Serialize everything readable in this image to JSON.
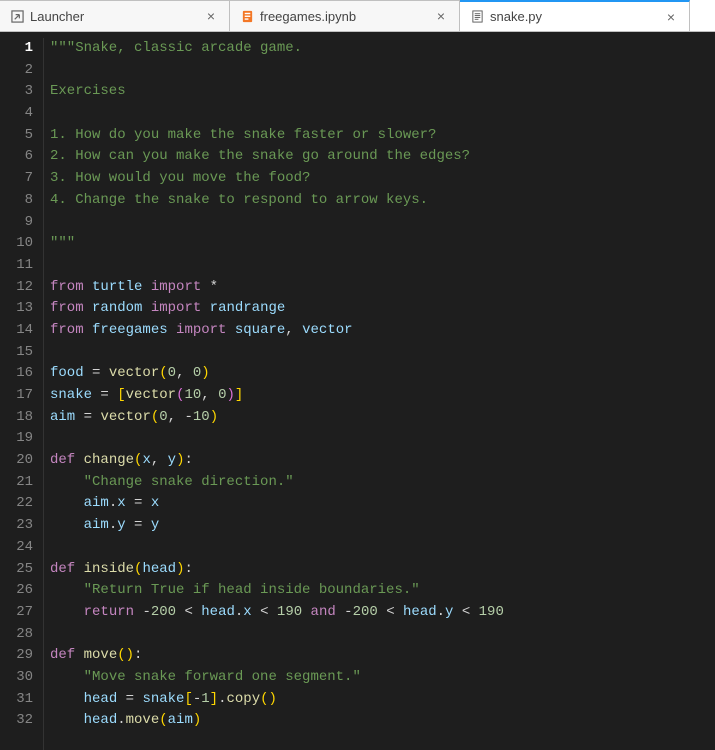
{
  "tabs": [
    {
      "label": "Launcher",
      "icon": "launcher"
    },
    {
      "label": "freegames.ipynb",
      "icon": "notebook"
    },
    {
      "label": "snake.py",
      "icon": "python",
      "active": true
    }
  ],
  "code": {
    "lines": [
      [
        {
          "t": "str",
          "v": "\"\"\"Snake, classic arcade game."
        }
      ],
      [],
      [
        {
          "t": "str",
          "v": "Exercises"
        }
      ],
      [],
      [
        {
          "t": "str",
          "v": "1. How do you make the snake faster or slower?"
        }
      ],
      [
        {
          "t": "str",
          "v": "2. How can you make the snake go around the edges?"
        }
      ],
      [
        {
          "t": "str",
          "v": "3. How would you move the food?"
        }
      ],
      [
        {
          "t": "str",
          "v": "4. Change the snake to respond to arrow keys."
        }
      ],
      [],
      [
        {
          "t": "str",
          "v": "\"\"\""
        }
      ],
      [],
      [
        {
          "t": "key",
          "v": "from"
        },
        {
          "t": "op",
          "v": " "
        },
        {
          "t": "mod",
          "v": "turtle"
        },
        {
          "t": "op",
          "v": " "
        },
        {
          "t": "key",
          "v": "import"
        },
        {
          "t": "op",
          "v": " "
        },
        {
          "t": "op",
          "v": "*"
        }
      ],
      [
        {
          "t": "key",
          "v": "from"
        },
        {
          "t": "op",
          "v": " "
        },
        {
          "t": "mod",
          "v": "random"
        },
        {
          "t": "op",
          "v": " "
        },
        {
          "t": "key",
          "v": "import"
        },
        {
          "t": "op",
          "v": " "
        },
        {
          "t": "mod",
          "v": "randrange"
        }
      ],
      [
        {
          "t": "key",
          "v": "from"
        },
        {
          "t": "op",
          "v": " "
        },
        {
          "t": "mod",
          "v": "freegames"
        },
        {
          "t": "op",
          "v": " "
        },
        {
          "t": "key",
          "v": "import"
        },
        {
          "t": "op",
          "v": " "
        },
        {
          "t": "mod",
          "v": "square"
        },
        {
          "t": "op",
          "v": ", "
        },
        {
          "t": "mod",
          "v": "vector"
        }
      ],
      [],
      [
        {
          "t": "id",
          "v": "food"
        },
        {
          "t": "op",
          "v": " = "
        },
        {
          "t": "fn",
          "v": "vector"
        },
        {
          "t": "bracket1",
          "v": "("
        },
        {
          "t": "num",
          "v": "0"
        },
        {
          "t": "op",
          "v": ", "
        },
        {
          "t": "num",
          "v": "0"
        },
        {
          "t": "bracket1",
          "v": ")"
        }
      ],
      [
        {
          "t": "id",
          "v": "snake"
        },
        {
          "t": "op",
          "v": " = "
        },
        {
          "t": "bracket1",
          "v": "["
        },
        {
          "t": "fn",
          "v": "vector"
        },
        {
          "t": "bracket2",
          "v": "("
        },
        {
          "t": "num",
          "v": "10"
        },
        {
          "t": "op",
          "v": ", "
        },
        {
          "t": "num",
          "v": "0"
        },
        {
          "t": "bracket2",
          "v": ")"
        },
        {
          "t": "bracket1",
          "v": "]"
        }
      ],
      [
        {
          "t": "id",
          "v": "aim"
        },
        {
          "t": "op",
          "v": " = "
        },
        {
          "t": "fn",
          "v": "vector"
        },
        {
          "t": "bracket1",
          "v": "("
        },
        {
          "t": "num",
          "v": "0"
        },
        {
          "t": "op",
          "v": ", "
        },
        {
          "t": "op",
          "v": "-"
        },
        {
          "t": "num",
          "v": "10"
        },
        {
          "t": "bracket1",
          "v": ")"
        }
      ],
      [],
      [
        {
          "t": "key",
          "v": "def"
        },
        {
          "t": "op",
          "v": " "
        },
        {
          "t": "fn",
          "v": "change"
        },
        {
          "t": "bracket1",
          "v": "("
        },
        {
          "t": "id",
          "v": "x"
        },
        {
          "t": "op",
          "v": ", "
        },
        {
          "t": "id",
          "v": "y"
        },
        {
          "t": "bracket1",
          "v": ")"
        },
        {
          "t": "op",
          "v": ":"
        }
      ],
      [
        {
          "t": "op",
          "v": "    "
        },
        {
          "t": "str",
          "v": "\"Change snake direction.\""
        }
      ],
      [
        {
          "t": "op",
          "v": "    "
        },
        {
          "t": "id",
          "v": "aim"
        },
        {
          "t": "op",
          "v": "."
        },
        {
          "t": "id",
          "v": "x"
        },
        {
          "t": "op",
          "v": " = "
        },
        {
          "t": "id",
          "v": "x"
        }
      ],
      [
        {
          "t": "op",
          "v": "    "
        },
        {
          "t": "id",
          "v": "aim"
        },
        {
          "t": "op",
          "v": "."
        },
        {
          "t": "id",
          "v": "y"
        },
        {
          "t": "op",
          "v": " = "
        },
        {
          "t": "id",
          "v": "y"
        }
      ],
      [],
      [
        {
          "t": "key",
          "v": "def"
        },
        {
          "t": "op",
          "v": " "
        },
        {
          "t": "fn",
          "v": "inside"
        },
        {
          "t": "bracket1",
          "v": "("
        },
        {
          "t": "id",
          "v": "head"
        },
        {
          "t": "bracket1",
          "v": ")"
        },
        {
          "t": "op",
          "v": ":"
        }
      ],
      [
        {
          "t": "op",
          "v": "    "
        },
        {
          "t": "str",
          "v": "\"Return True if head inside boundaries.\""
        }
      ],
      [
        {
          "t": "op",
          "v": "    "
        },
        {
          "t": "ret",
          "v": "return"
        },
        {
          "t": "op",
          "v": " "
        },
        {
          "t": "op",
          "v": "-"
        },
        {
          "t": "num",
          "v": "200"
        },
        {
          "t": "op",
          "v": " < "
        },
        {
          "t": "id",
          "v": "head"
        },
        {
          "t": "op",
          "v": "."
        },
        {
          "t": "id",
          "v": "x"
        },
        {
          "t": "op",
          "v": " < "
        },
        {
          "t": "num",
          "v": "190"
        },
        {
          "t": "op",
          "v": " "
        },
        {
          "t": "key",
          "v": "and"
        },
        {
          "t": "op",
          "v": " "
        },
        {
          "t": "op",
          "v": "-"
        },
        {
          "t": "num",
          "v": "200"
        },
        {
          "t": "op",
          "v": " < "
        },
        {
          "t": "id",
          "v": "head"
        },
        {
          "t": "op",
          "v": "."
        },
        {
          "t": "id",
          "v": "y"
        },
        {
          "t": "op",
          "v": " < "
        },
        {
          "t": "num",
          "v": "190"
        }
      ],
      [],
      [
        {
          "t": "key",
          "v": "def"
        },
        {
          "t": "op",
          "v": " "
        },
        {
          "t": "fn",
          "v": "move"
        },
        {
          "t": "bracket1",
          "v": "()"
        },
        {
          "t": "op",
          "v": ":"
        }
      ],
      [
        {
          "t": "op",
          "v": "    "
        },
        {
          "t": "str",
          "v": "\"Move snake forward one segment.\""
        }
      ],
      [
        {
          "t": "op",
          "v": "    "
        },
        {
          "t": "id",
          "v": "head"
        },
        {
          "t": "op",
          "v": " = "
        },
        {
          "t": "id",
          "v": "snake"
        },
        {
          "t": "bracket1",
          "v": "["
        },
        {
          "t": "op",
          "v": "-"
        },
        {
          "t": "num",
          "v": "1"
        },
        {
          "t": "bracket1",
          "v": "]"
        },
        {
          "t": "op",
          "v": "."
        },
        {
          "t": "fn",
          "v": "copy"
        },
        {
          "t": "bracket1",
          "v": "()"
        }
      ],
      [
        {
          "t": "op",
          "v": "    "
        },
        {
          "t": "id",
          "v": "head"
        },
        {
          "t": "op",
          "v": "."
        },
        {
          "t": "fn",
          "v": "move"
        },
        {
          "t": "bracket1",
          "v": "("
        },
        {
          "t": "id",
          "v": "aim"
        },
        {
          "t": "bracket1",
          "v": ")"
        }
      ]
    ]
  }
}
